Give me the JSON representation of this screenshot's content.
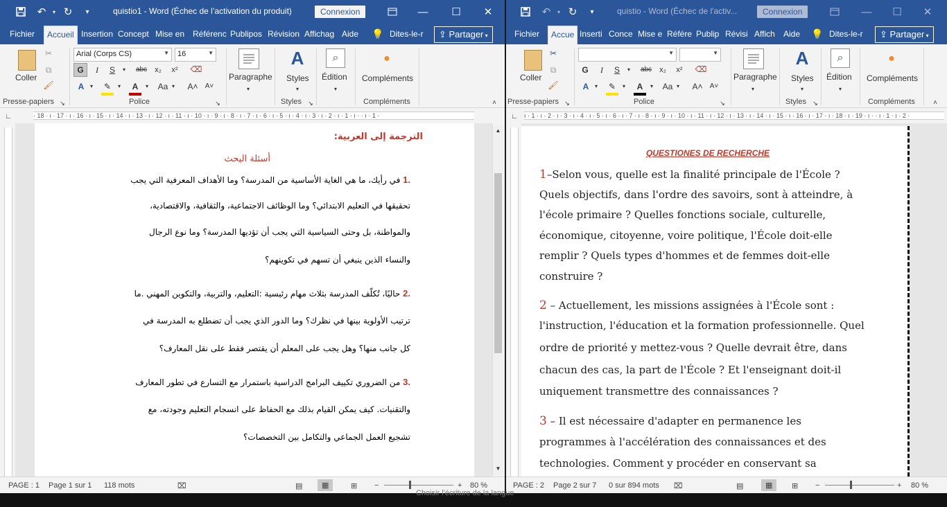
{
  "win1": {
    "title": "quistio1  -  Word (Échec de l’activation du produit)",
    "connexion": "Connexion",
    "tabs": [
      "Fichier",
      "Accueil",
      "Insertion",
      "Concept",
      "Mise en",
      "Référenc",
      "Publipos",
      "Révision",
      "Affichag",
      "Aide"
    ],
    "tell": "Dites-le-r",
    "share": "Partager",
    "font_name": "Arial (Corps CS)",
    "font_size": "16",
    "groups": {
      "clipboard": "Presse-papiers",
      "font": "Police",
      "styles": "Styles",
      "addins": "Compléments"
    },
    "big": {
      "paste": "Coller",
      "paragraph": "Paragraphe",
      "styles": "Styles",
      "edition": "Édition",
      "addins": "Compléments"
    },
    "ruler": "· 18 · ı · 17 · ı · 16 · ı · 15 · ı · 14 · ı · 13 · ı · 12 · ı · 11 · ı · 10 · ı · 9 · ı · 8 · ı · 7 · ı · 6 · ı · 5 · ı · 4 · ı · 3 · ı · 2 · ı · 1 · ı · · ı · 1 ·",
    "doc": {
      "heading": "الترجمة إلى العربية:",
      "subheading": "أسئلة البحث",
      "lines": [
        {
          "num": ".1",
          "text": " في رأيك، ما هي الغاية الأساسية من المدرسة؟ وما الأهداف المعرفية التي يجب"
        },
        {
          "num": "",
          "text": "تحقيقها في التعليم الابتدائي؟ وما الوظائف الاجتماعية، والثقافية، والاقتصادية،"
        },
        {
          "num": "",
          "text": "والمواطنة، بل وحتى السياسية التي يجب أن تؤديها المدرسة؟ وما نوع الرجال"
        },
        {
          "num": "",
          "text": "والنساء الذين ينبغي أن تسهم في تكوينهم؟"
        },
        {
          "num": ".2",
          "text": " حاليًا، تُكلّف المدرسة بثلاث مهام رئيسية :التعليم، والتربية، والتكوين المهني .ما"
        },
        {
          "num": "",
          "text": "ترتيب الأولوية بينها في نظرك؟ وما الدور الذي يجب أن تضطلع به المدرسة في"
        },
        {
          "num": "",
          "text": "كل جانب منها؟ وهل يجب على المعلم أن يقتصر فقط على نقل المعارف؟"
        },
        {
          "num": ".3",
          "text": " من الضروري تكييف البرامج الدراسية باستمرار مع التسارع في تطور المعارف"
        },
        {
          "num": "",
          "text": "والتقنيات. كيف يمكن القيام بذلك مع الحفاظ على انسجام التعليم وجودته، مع"
        },
        {
          "num": "",
          "text": "تشجيع العمل الجماعي والتكامل بين التخصصات؟"
        }
      ]
    },
    "status": {
      "page": "PAGE : 1",
      "pages": "Page 1 sur 1",
      "words": "118 mots",
      "zoom": "80 %"
    }
  },
  "win2": {
    "title": "quistio  -  Word (Échec de l'activ...",
    "connexion": "Connexion",
    "tabs": [
      "Fichier",
      "Accue",
      "Inserti",
      "Conce",
      "Mise e",
      "Référe",
      "Publip",
      "Révisi",
      "Affich",
      "Aide"
    ],
    "tell": "Dites-le-r",
    "share": "Partager",
    "groups": {
      "clipboard": "Presse-papiers",
      "font": "Police",
      "styles": "Styles",
      "addins": "Compléments"
    },
    "big": {
      "paste": "Coller",
      "paragraph": "Paragraphe",
      "styles": "Styles",
      "edition": "Édition",
      "addins": "Compléments"
    },
    "ruler": "ı · 1 · ı · 2 · ı · 3 · ı · 4 · ı · 5 · ı · 6 · ı · 7 · ı · 8 · ı · 9 · ı · 10 · ı · 11 · ı · 12 · ı · 13 · ı · 14 · ı · 15 · ı · 16 · ı · 17 · ı · 18 · ı · 19 · ı · · ı · 1 · ı · 2 ·",
    "doc": {
      "heading": "QUESTIONES DE RECHERCHE",
      "lines": [
        {
          "num": "1",
          "text": "–Selon vous, quelle est la finalité principale de l'École ?"
        },
        {
          "num": "",
          "text": "Quels objectifs, dans l'ordre des savoirs, sont à atteindre, à"
        },
        {
          "num": "",
          "text": "l'école primaire ? Quelles fonctions sociale, culturelle,"
        },
        {
          "num": "",
          "text": "économique, citoyenne, voire politique, l'École doit-elle"
        },
        {
          "num": "",
          "text": "remplir ? Quels types d'hommes et de femmes doit-elle"
        },
        {
          "num": "",
          "text": "construire ?"
        },
        {
          "num": "2",
          "text": " – Actuellement, les missions assignées à l'École sont :"
        },
        {
          "num": "",
          "text": "l'instruction, l'éducation et la formation professionnelle. Quel"
        },
        {
          "num": "",
          "text": "ordre de priorité y mettez-vous ? Quelle devrait être, dans"
        },
        {
          "num": "",
          "text": "chacun des cas, la part de l'École ? Et l'enseignant doit-il"
        },
        {
          "num": "",
          "text": "uniquement transmettre des connaissances ?"
        },
        {
          "num": "3",
          "text": " – Il est nécessaire d'adapter en permanence les"
        },
        {
          "num": "",
          "text": "programmes à l'accélération des connaissances et des"
        },
        {
          "num": "",
          "text": "technologies. Comment y procéder en conservant sa"
        }
      ]
    },
    "status": {
      "page": "PAGE : 2",
      "pages": "Page 2 sur 7",
      "words": "0 sur 894 mots",
      "zoom": "80 %"
    }
  },
  "bottom_strip": "Choisir l'écriture de la langue"
}
